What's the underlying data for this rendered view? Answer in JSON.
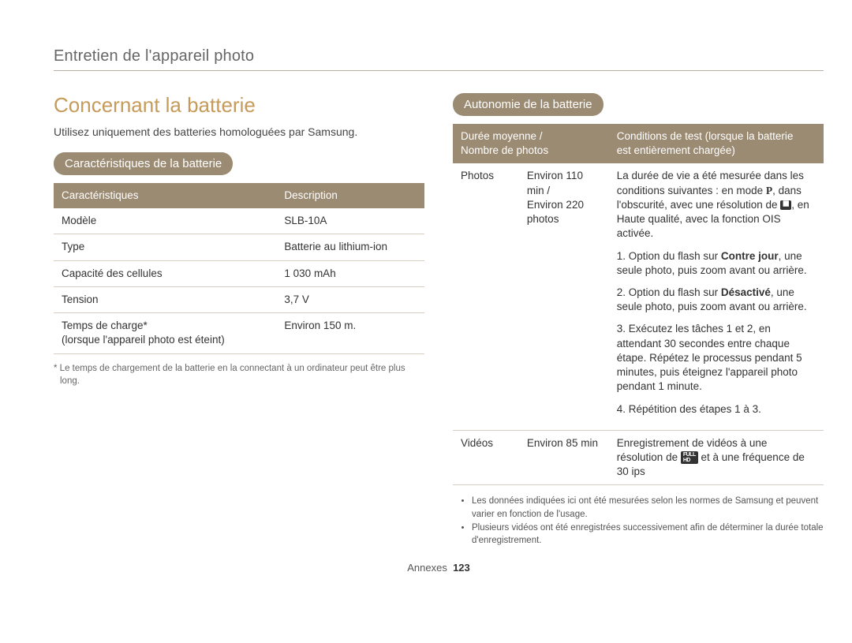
{
  "breadcrumb": "Entretien de l'appareil photo",
  "title": "Concernant la batterie",
  "intro": "Utilisez uniquement des batteries homologuées par Samsung.",
  "specs": {
    "heading": "Caractéristiques de la batterie",
    "headers": {
      "c1": "Caractéristiques",
      "c2": "Description"
    },
    "rows": {
      "model": {
        "k": "Modèle",
        "v": "SLB-10A"
      },
      "type": {
        "k": "Type",
        "v": "Batterie au lithium-ion"
      },
      "capacity": {
        "k": "Capacité des cellules",
        "v": "1 030 mAh"
      },
      "voltage": {
        "k": "Tension",
        "v": "3,7 V"
      },
      "charge": {
        "k1": "Temps de charge*",
        "k2": "(lorsque l'appareil photo est éteint)",
        "v": "Environ 150 m."
      }
    },
    "footnote": "* Le temps de chargement de la batterie en la connectant à un ordinateur peut être plus long."
  },
  "autonomy": {
    "heading": "Autonomie de la batterie",
    "headers": {
      "c1a": "Durée moyenne /",
      "c1b": "Nombre de photos",
      "c2a": "Conditions de test (lorsque la batterie",
      "c2b": "est entièrement chargée)"
    },
    "photos": {
      "label": "Photos",
      "duration1": "Environ 110 min /",
      "duration2": "Environ 220 photos",
      "intro1": "La durée de vie a été mesurée dans les conditions suivantes : en mode ",
      "intro2": ", dans l'obscurité, avec une résolution de ",
      "intro3": ", en Haute qualité, avec la fonction OIS activée.",
      "li1a": "1. Option du flash sur ",
      "li1b": "Contre jour",
      "li1c": ", une seule photo, puis zoom avant ou arrière.",
      "li2a": "2. Option du flash sur ",
      "li2b": "Désactivé",
      "li2c": ", une seule photo, puis zoom avant ou arrière.",
      "li3": "3. Exécutez les tâches 1 et 2, en attendant 30 secondes entre chaque étape. Répétez le processus pendant 5 minutes, puis éteignez l'appareil photo pendant 1 minute.",
      "li4": "4. Répétition des étapes 1 à 3."
    },
    "videos": {
      "label": "Vidéos",
      "duration": "Environ 85 min",
      "cond1": "Enregistrement de vidéos à une résolution de ",
      "cond2": " et à une fréquence de 30 ips"
    },
    "notes": {
      "n1": "Les données indiquées ici ont été mesurées selon les normes de Samsung et peuvent varier en fonction de l'usage.",
      "n2": "Plusieurs vidéos ont été enregistrées successivement afin de déterminer la durée totale d'enregistrement."
    }
  },
  "footer": {
    "label": "Annexes",
    "page": "123"
  },
  "icons": {
    "p": "P",
    "res": "⯀",
    "fullhd": "FULL HD"
  }
}
